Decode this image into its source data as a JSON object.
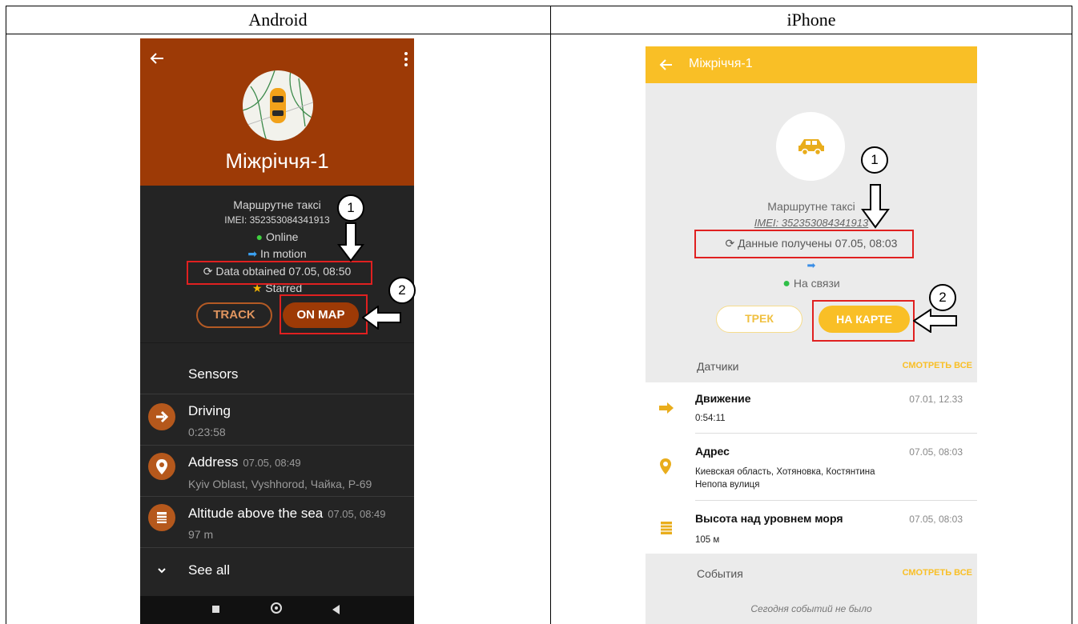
{
  "columns": {
    "left_title": "Android",
    "right_title": "iPhone"
  },
  "android": {
    "title": "Міжріччя-1",
    "group": "Маршрутне таксі",
    "imei": "IMEI: 352353084341913",
    "online": "Online",
    "motion": "In motion",
    "data_obtained": "Data obtained 07.05, 08:50",
    "starred": "Starred",
    "track_button": "TRACK",
    "on_map_button": "ON MAP",
    "sensors_title": "Sensors",
    "sensors": [
      {
        "name": "Driving",
        "time": "",
        "value": "0:23:58",
        "icon": "arrow-right-icon"
      },
      {
        "name": "Address",
        "time": "07.05, 08:49",
        "value": "Kyiv Oblast, Vyshhorod, Чайка, Р-69",
        "icon": "location-pin-icon"
      },
      {
        "name": "Altitude above the sea",
        "time": "07.05, 08:49",
        "value": "97 m",
        "icon": "altitude-icon"
      }
    ],
    "see_all": "See all",
    "colors": {
      "primary": "#9d3a06",
      "background": "#242424"
    }
  },
  "iphone": {
    "title": "Міжріччя-1",
    "group": "Маршрутне таксі",
    "imei": "IMEI: 352353084341913",
    "data_obtained": "Данные получены 07.05, 08:03",
    "online": "На связи",
    "track_button": "ТРЕК",
    "on_map_button": "НА КАРТЕ",
    "sensors_title": "Датчики",
    "see_all_link": "СМОТРЕТЬ ВСЕ",
    "sensors": [
      {
        "name": "Движение",
        "time": "07.01, 12.33",
        "value": "0:54:11",
        "icon": "arrow-right-icon"
      },
      {
        "name": "Адрес",
        "time": "07.05, 08:03",
        "value_line1": "Киевская область, Хотяновка, Костянтина",
        "value_line2": "Непопа вулиця",
        "icon": "location-pin-icon"
      },
      {
        "name": "Высота над уровнем моря",
        "time": "07.05, 08:03",
        "value": "105 м",
        "icon": "altitude-icon"
      }
    ],
    "events_title": "События",
    "events_link": "СМОТРЕТЬ ВСЕ",
    "events_empty": "Сегодня событий не было",
    "colors": {
      "primary": "#f9bf26",
      "background": "#ebebeb"
    }
  },
  "annotations": {
    "marker_1": "1",
    "marker_2": "2"
  }
}
